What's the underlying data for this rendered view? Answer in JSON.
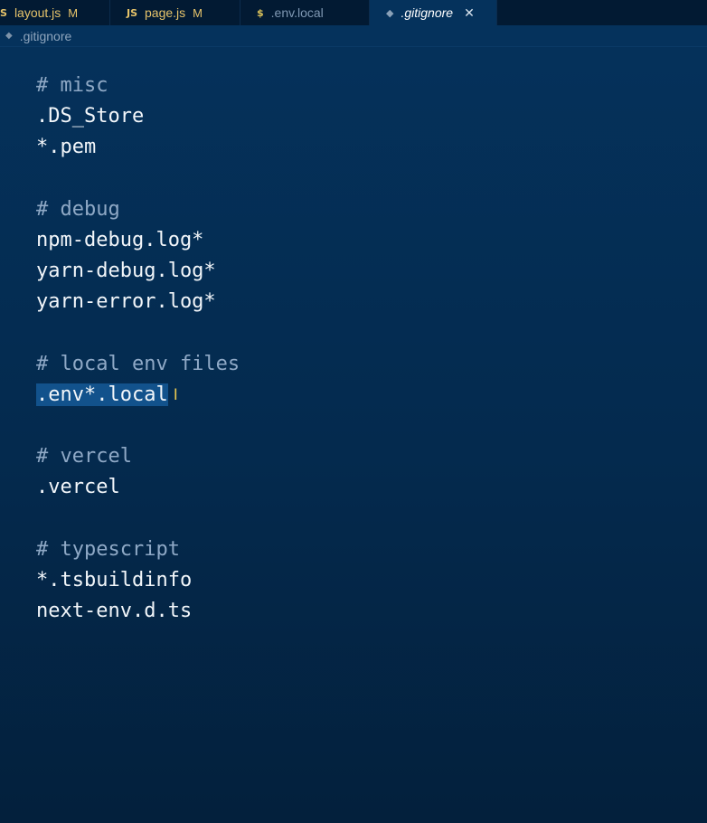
{
  "tabs": [
    {
      "icon": "S",
      "label": "layout.js",
      "badge": "M"
    },
    {
      "icon": "JS",
      "label": "page.js",
      "badge": "M"
    },
    {
      "icon": "$",
      "label": ".env.local"
    },
    {
      "icon": "◆",
      "label": ".gitignore",
      "close": "✕"
    }
  ],
  "breadcrumb": {
    "icon": "◆",
    "label": ".gitignore"
  },
  "editor": {
    "lines": [
      "# misc",
      ".DS_Store",
      "*.pem",
      "",
      "# debug",
      "npm-debug.log*",
      "yarn-debug.log*",
      "yarn-error.log*",
      "",
      "# local env files",
      ".env*.local",
      "",
      "# vercel",
      ".vercel",
      "",
      "# typescript",
      "*.tsbuildinfo",
      "next-env.d.ts"
    ],
    "cursor_glyph": "I"
  }
}
